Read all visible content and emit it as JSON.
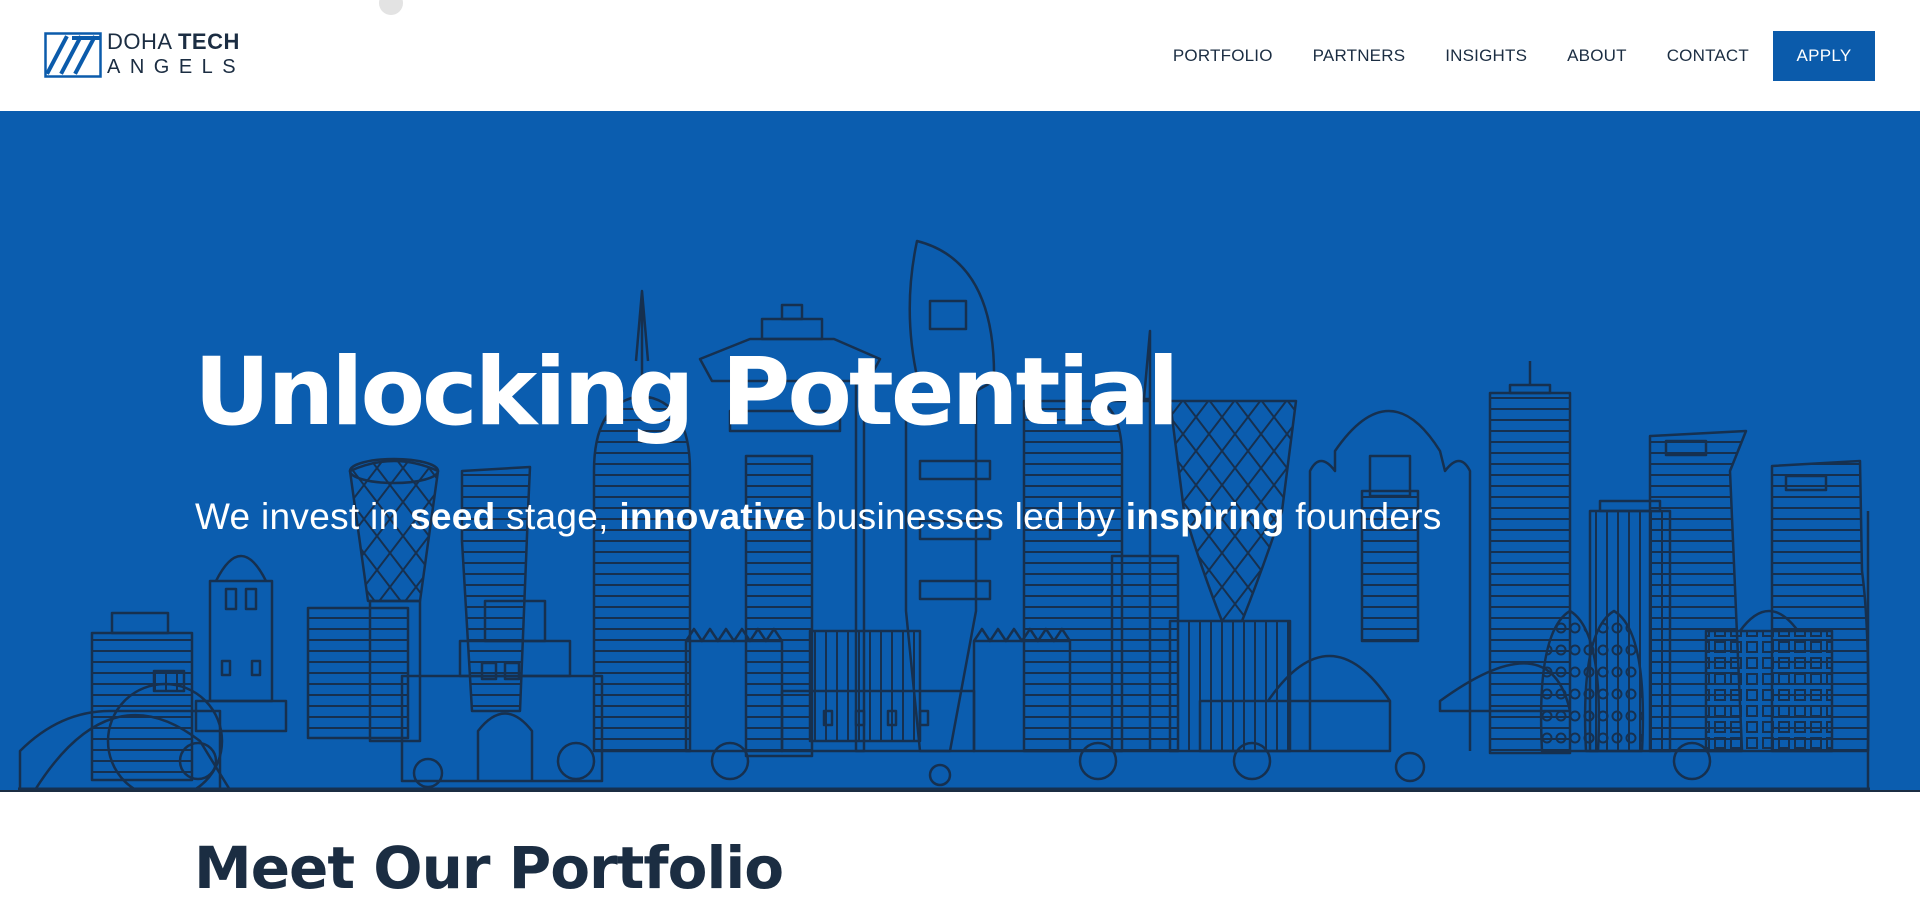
{
  "brand": {
    "line1_regular": "DOHA",
    "line1_bold": "TECH",
    "line2": "ANGELS",
    "mark_icon": "doha-tech-angels-logo-mark"
  },
  "nav": {
    "items": [
      "PORTFOLIO",
      "PARTNERS",
      "INSIGHTS",
      "ABOUT",
      "CONTACT"
    ],
    "apply_label": "APPLY"
  },
  "hero": {
    "title": "Unlocking Potential",
    "subtitle": {
      "p1": "We invest in ",
      "b1": "seed",
      "p2": "  stage, ",
      "b2": "innovative",
      "p3": " businesses led by ",
      "b3": "inspiring",
      "p4": " founders"
    },
    "background_illustration": "doha-city-skyline"
  },
  "section": {
    "title": "Meet Our Portfolio"
  },
  "colors": {
    "primary": "#0b5bab",
    "hero_background": "#0b5daf",
    "skyline_line": "#16304f",
    "text_dark": "#1b2d42",
    "white": "#ffffff"
  }
}
